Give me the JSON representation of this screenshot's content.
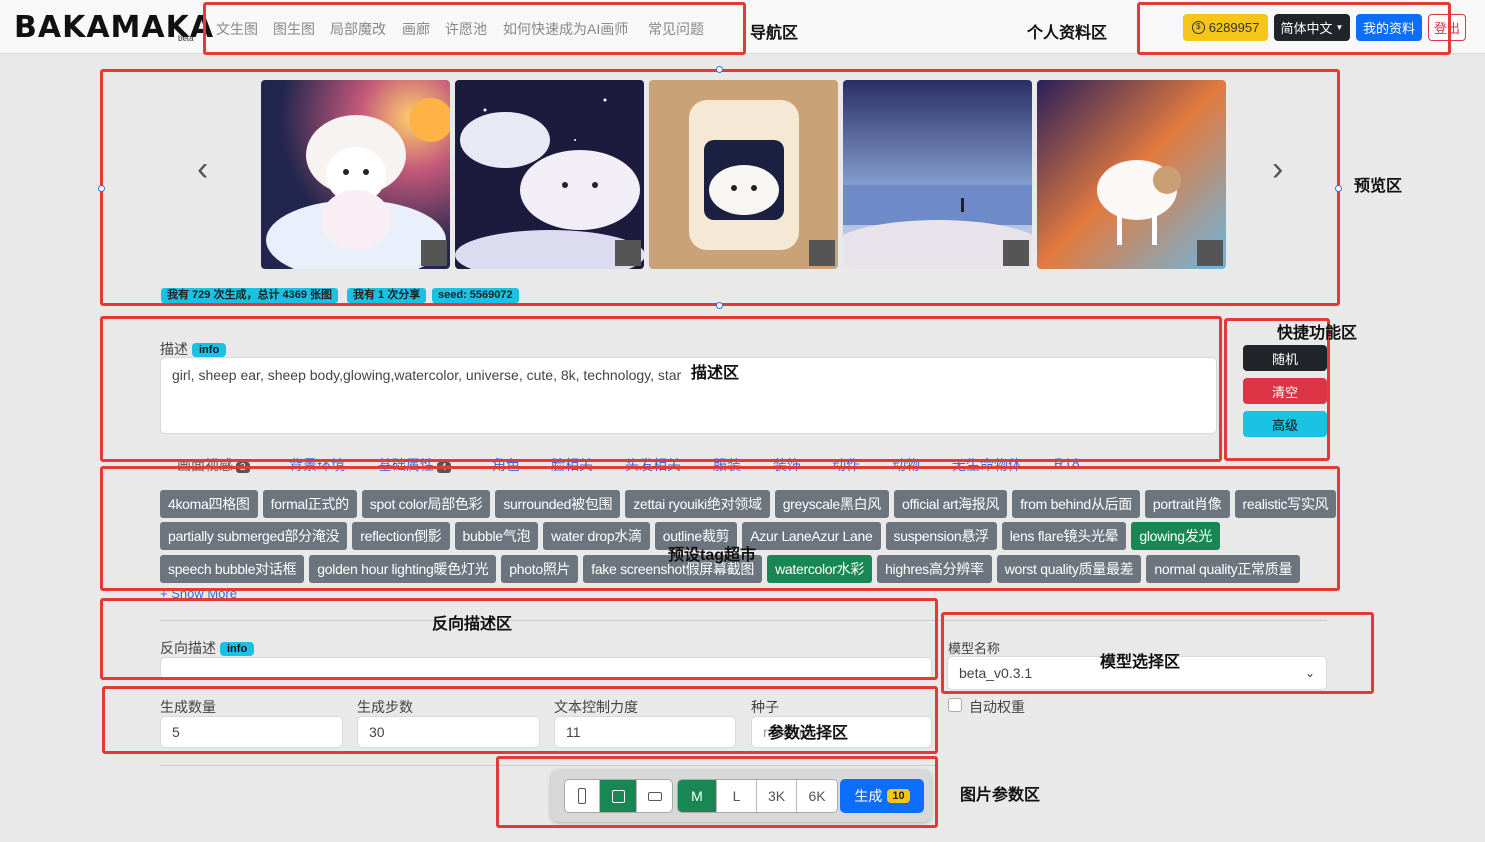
{
  "nav": {
    "logo": "BAKAMAKA",
    "logo_beta": "beta",
    "items": [
      "文生图",
      "图生图",
      "局部魔改",
      "画廊",
      "许愿池",
      "如何快速成为AI画师",
      "常见问题"
    ]
  },
  "account": {
    "coins": "6289957",
    "language": "简体中文",
    "profile": "我的资料",
    "logout": "登出"
  },
  "preview": {
    "images": [
      "sheep-galaxy-1",
      "sheep-clouds-2",
      "sheep-jar-3",
      "snowy-lake-4",
      "sheep-rainbow-5"
    ],
    "stats": [
      "我有 729 次生成，总计 4369 张图",
      "我有 1 次分享",
      "seed: 5569072"
    ]
  },
  "prompt": {
    "label": "描述",
    "info": "info",
    "value": "girl, sheep ear, sheep body,glowing,watercolor, universe, cute, 8k, technology, star"
  },
  "tabs": [
    {
      "label": "画面视感",
      "count": "2"
    },
    {
      "label": "背景环境"
    },
    {
      "label": "基础属性",
      "count": "4"
    },
    {
      "label": "角色"
    },
    {
      "label": "脸相关"
    },
    {
      "label": "头发相关"
    },
    {
      "label": "服装"
    },
    {
      "label": "装饰"
    },
    {
      "label": "动作"
    },
    {
      "label": "动物"
    },
    {
      "label": "无生命物体"
    },
    {
      "label": "R18"
    }
  ],
  "tags": {
    "row1": [
      {
        "text": "4koma四格图"
      },
      {
        "text": "formal正式的"
      },
      {
        "text": "spot color局部色彩"
      },
      {
        "text": "surrounded被包围"
      },
      {
        "text": "zettai ryouiki绝对领域"
      },
      {
        "text": "greyscale黑白风"
      },
      {
        "text": "official art海报风"
      },
      {
        "text": "from behind从后面"
      },
      {
        "text": "portrait肖像"
      },
      {
        "text": "realistic写实风"
      }
    ],
    "row2": [
      {
        "text": "partially submerged部分淹没"
      },
      {
        "text": "reflection倒影"
      },
      {
        "text": "bubble气泡"
      },
      {
        "text": "water drop水滴"
      },
      {
        "text": "outline裁剪"
      },
      {
        "text": "Azur LaneAzur Lane"
      },
      {
        "text": "suspension悬浮"
      },
      {
        "text": "lens flare镜头光晕"
      },
      {
        "text": "glowing发光",
        "on": true
      }
    ],
    "row3": [
      {
        "text": "speech bubble对话框"
      },
      {
        "text": "golden hour lighting暖色灯光"
      },
      {
        "text": "photo照片"
      },
      {
        "text": "fake screenshot假屏幕截图"
      },
      {
        "text": "watercolor水彩",
        "on": true
      },
      {
        "text": "highres高分辨率"
      },
      {
        "text": "worst quality质量最差"
      },
      {
        "text": "normal quality正常质量"
      }
    ],
    "show_more": "+ Show More"
  },
  "quick": {
    "random": "随机",
    "clear": "清空",
    "advanced": "高级"
  },
  "negative": {
    "label": "反向描述",
    "info": "info",
    "value": ""
  },
  "model": {
    "label": "模型名称",
    "value": "beta_v0.3.1",
    "auto_weight": "自动权重"
  },
  "params": {
    "count_label": "生成数量",
    "count": "5",
    "steps_label": "生成步数",
    "steps": "30",
    "cfg_label": "文本控制力度",
    "cfg": "11",
    "seed_label": "种子",
    "seed_placeholder": "random"
  },
  "image_params": {
    "orientations": [
      "portrait-icon",
      "square-icon",
      "landscape-icon"
    ],
    "sizes": [
      "M",
      "L",
      "3K",
      "6K"
    ],
    "generate": "生成",
    "generate_count": "10"
  },
  "annotations": {
    "nav": "导航区",
    "profile": "个人资料区",
    "preview": "预览区",
    "quick": "快捷功能区",
    "prompt": "描述区",
    "tags": "预设tag超市",
    "negative": "反向描述区",
    "model": "模型选择区",
    "params": "参数选择区",
    "image": "图片参数区"
  },
  "colors": {
    "coin": "#f5c518",
    "lang": "#212529",
    "primary": "#0d6efd",
    "danger": "#dc3545",
    "info": "#19c1e3",
    "success": "#198754",
    "tag": "#6c757d",
    "annotation_border": "#e53935"
  }
}
